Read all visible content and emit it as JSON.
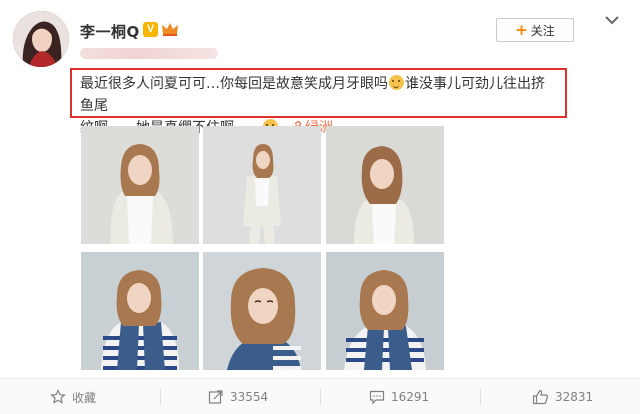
{
  "user": {
    "name": "李一桐Q",
    "vip_badge": "V"
  },
  "follow_button": {
    "plus": "+",
    "label": "关注"
  },
  "post": {
    "line1": "最近很多人问夏可可…你每回是故意笑成月牙眼吗",
    "line1_after": "谁没事儿可劲儿往出挤鱼尾",
    "line2": "纹啊……她是真绷不住啊……",
    "link_label": "绿洲"
  },
  "photos": [
    {
      "name": "photo-1",
      "bg": "#dcdcd9"
    },
    {
      "name": "photo-2",
      "bg": "#dedede"
    },
    {
      "name": "photo-3",
      "bg": "#d9d9d6"
    },
    {
      "name": "photo-4",
      "bg": "#c9d0d4"
    },
    {
      "name": "photo-5",
      "bg": "#cfd5d8"
    },
    {
      "name": "photo-6",
      "bg": "#c6ced2"
    }
  ],
  "toolbar": {
    "favorite": "收藏",
    "share_count": "33554",
    "comment_count": "16291",
    "like_count": "32831"
  },
  "colors": {
    "highlight_border": "#e0302d",
    "link": "#eb7350",
    "follow_plus": "#ff8200",
    "vip": "#f7b500"
  }
}
